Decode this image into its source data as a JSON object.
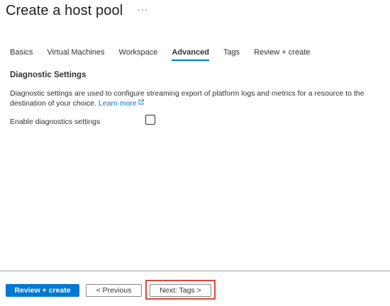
{
  "header": {
    "title": "Create a host pool",
    "more_label": "···"
  },
  "tabs": [
    {
      "label": "Basics",
      "active": false
    },
    {
      "label": "Virtual Machines",
      "active": false
    },
    {
      "label": "Workspace",
      "active": false
    },
    {
      "label": "Advanced",
      "active": true
    },
    {
      "label": "Tags",
      "active": false
    },
    {
      "label": "Review + create",
      "active": false
    }
  ],
  "diagnostics": {
    "heading": "Diagnostic Settings",
    "description": "Diagnostic settings are used to configure streaming export of platform logs and metrics for a resource to the destination of your choice.",
    "learn_more": "Learn more",
    "enable_label": "Enable diagnostics settings",
    "enable_checked": false
  },
  "footer": {
    "review_create_label": "Review + create",
    "previous_label": "< Previous",
    "next_label": "Next: Tags >"
  },
  "colors": {
    "accent": "#0078d4",
    "highlight": "#e0453a"
  }
}
